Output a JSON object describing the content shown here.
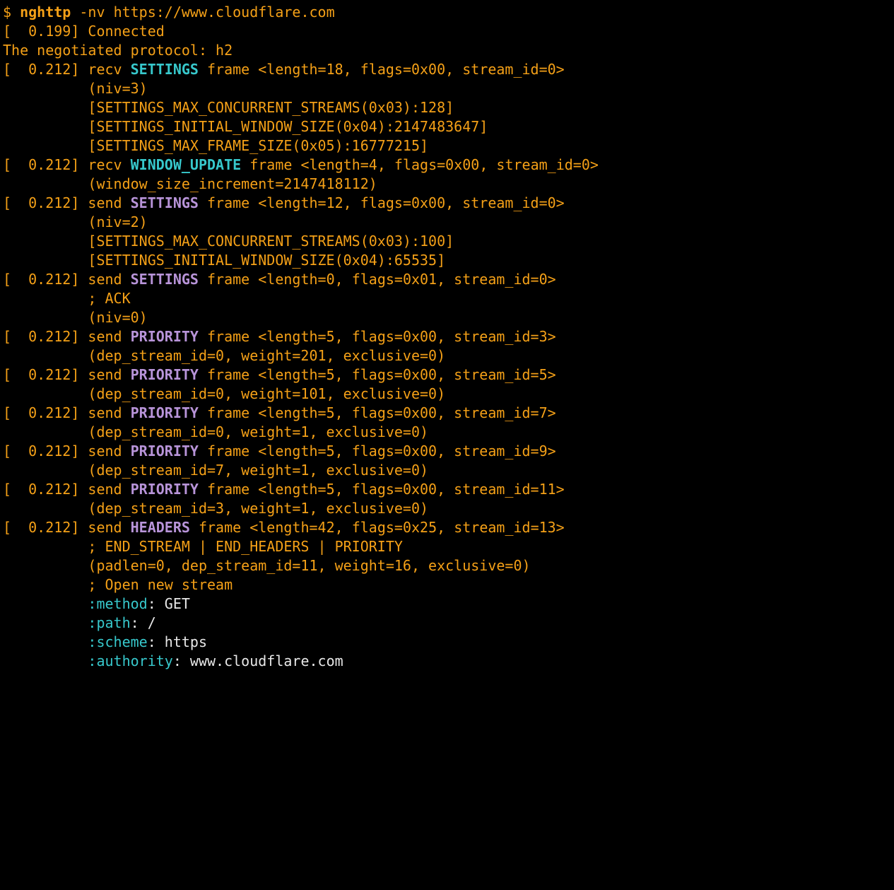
{
  "prompt": "$ ",
  "cmd_name": "nghttp",
  "cmd_flags": " -nv ",
  "cmd_url": "https://www.cloudflare.com",
  "connected_ts": "[  0.199]",
  "connected_msg": " Connected",
  "protocol_line": "The negotiated protocol: h2",
  "settings_recv": {
    "ts": "[  0.212]",
    "dir": " recv ",
    "frame": "SETTINGS",
    "tail": " frame <length=18, flags=0x00, stream_id=0>",
    "niv": "          (niv=3)",
    "s1": "          [SETTINGS_MAX_CONCURRENT_STREAMS(0x03):128]",
    "s2": "          [SETTINGS_INITIAL_WINDOW_SIZE(0x04):2147483647]",
    "s3": "          [SETTINGS_MAX_FRAME_SIZE(0x05):16777215]"
  },
  "winupdate": {
    "ts": "[  0.212]",
    "dir": " recv ",
    "frame": "WINDOW_UPDATE",
    "tail": " frame <length=4, flags=0x00, stream_id=0>",
    "detail": "          (window_size_increment=2147418112)"
  },
  "settings_send1": {
    "ts": "[  0.212]",
    "dir": " send ",
    "frame": "SETTINGS",
    "tail": " frame <length=12, flags=0x00, stream_id=0>",
    "niv": "          (niv=2)",
    "s1": "          [SETTINGS_MAX_CONCURRENT_STREAMS(0x03):100]",
    "s2": "          [SETTINGS_INITIAL_WINDOW_SIZE(0x04):65535]"
  },
  "settings_send2": {
    "ts": "[  0.212]",
    "dir": " send ",
    "frame": "SETTINGS",
    "tail": " frame <length=0, flags=0x01, stream_id=0>",
    "ack": "          ; ACK",
    "niv": "          (niv=0)"
  },
  "priority1": {
    "ts": "[  0.212]",
    "dir": " send ",
    "frame": "PRIORITY",
    "tail": " frame <length=5, flags=0x00, stream_id=3>",
    "detail": "          (dep_stream_id=0, weight=201, exclusive=0)"
  },
  "priority2": {
    "ts": "[  0.212]",
    "dir": " send ",
    "frame": "PRIORITY",
    "tail": " frame <length=5, flags=0x00, stream_id=5>",
    "detail": "          (dep_stream_id=0, weight=101, exclusive=0)"
  },
  "priority3": {
    "ts": "[  0.212]",
    "dir": " send ",
    "frame": "PRIORITY",
    "tail": " frame <length=5, flags=0x00, stream_id=7>",
    "detail": "          (dep_stream_id=0, weight=1, exclusive=0)"
  },
  "priority4": {
    "ts": "[  0.212]",
    "dir": " send ",
    "frame": "PRIORITY",
    "tail": " frame <length=5, flags=0x00, stream_id=9>",
    "detail": "          (dep_stream_id=7, weight=1, exclusive=0)"
  },
  "priority5": {
    "ts": "[  0.212]",
    "dir": " send ",
    "frame": "PRIORITY",
    "tail": " frame <length=5, flags=0x00, stream_id=11>",
    "detail": "          (dep_stream_id=3, weight=1, exclusive=0)"
  },
  "headers": {
    "ts": "[  0.212]",
    "dir": " send ",
    "frame": "HEADERS",
    "tail": " frame <length=42, flags=0x25, stream_id=13>",
    "flagsline": "          ; END_STREAM | END_HEADERS | PRIORITY",
    "params": "          (padlen=0, dep_stream_id=11, weight=16, exclusive=0)",
    "open": "          ; Open new stream",
    "method_k": "          :method",
    "method_v": ": GET",
    "path_k": "          :path",
    "path_v": ": /",
    "scheme_k": "          :scheme",
    "scheme_v": ": https",
    "auth_k": "          :authority",
    "auth_v": ": www.cloudflare.com"
  }
}
